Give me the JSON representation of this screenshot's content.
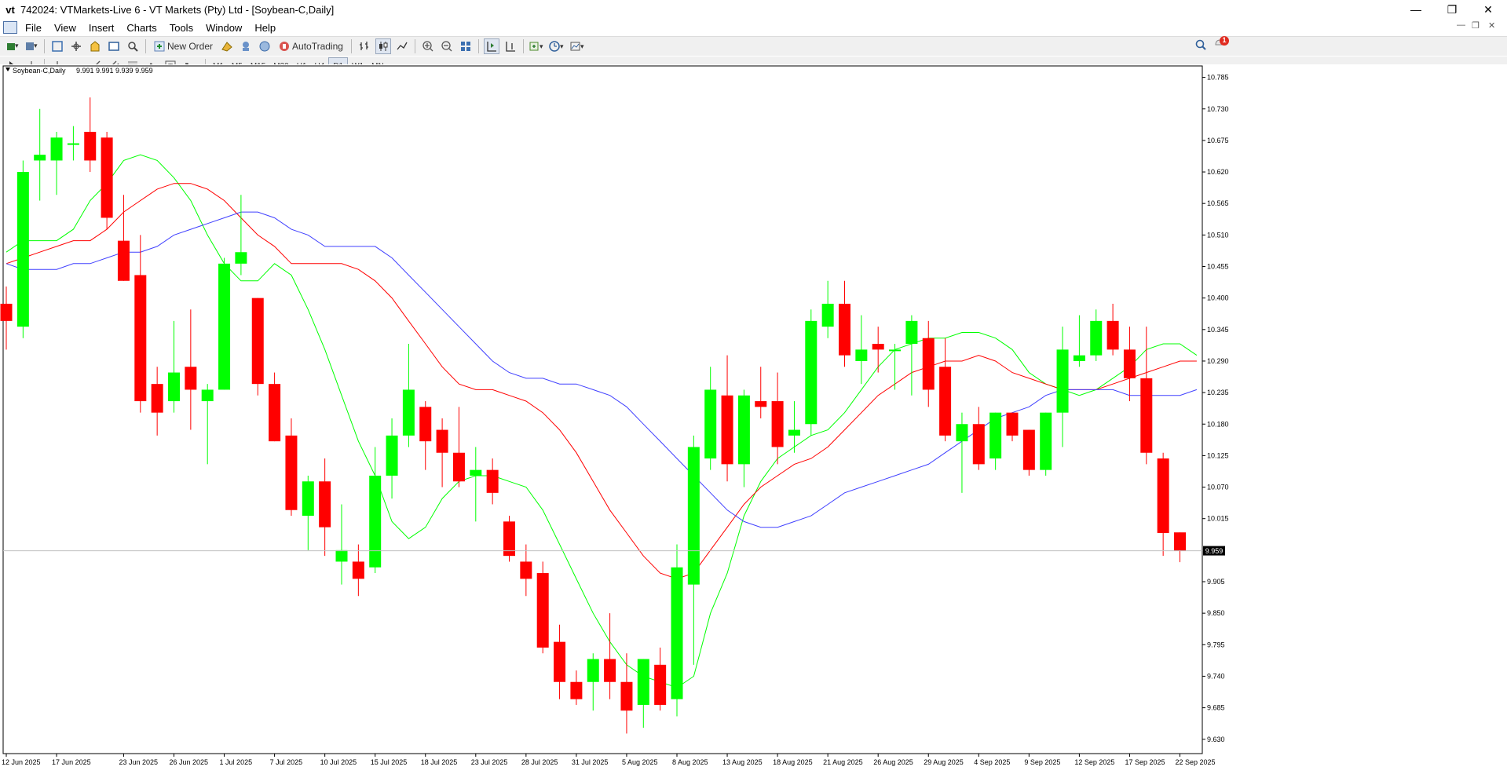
{
  "window": {
    "title": "742024: VTMarkets-Live 6 - VT Markets (Pty) Ltd - [Soybean-C,Daily]",
    "logo": "vt"
  },
  "menu": [
    "File",
    "View",
    "Insert",
    "Charts",
    "Tools",
    "Window",
    "Help"
  ],
  "toolbar": {
    "new_order": "New Order",
    "autotrading": "AutoTrading",
    "notification_count": "1"
  },
  "timeframes": [
    "M1",
    "M5",
    "M15",
    "M30",
    "H1",
    "H4",
    "D1",
    "W1",
    "MN"
  ],
  "active_timeframe": "D1",
  "icons": {
    "minimize": "minimize-icon",
    "maximize": "restore-icon",
    "close": "close-icon",
    "search": "search-icon",
    "notification": "notification-icon"
  },
  "chart_data": {
    "type": "candlestick",
    "title": "Soybean-C,Daily",
    "ohlc_label": "9.991 9.991 9.939 9.959",
    "current_price": 9.959,
    "current_price_label": "9.959",
    "ylim": [
      9.605,
      10.805
    ],
    "y_ticks": [
      9.63,
      9.685,
      9.74,
      9.795,
      9.85,
      9.905,
      10.015,
      10.07,
      10.125,
      10.18,
      10.235,
      10.29,
      10.345,
      10.4,
      10.455,
      10.51,
      10.565,
      10.62,
      10.675,
      10.73,
      10.785
    ],
    "x_tick_labels": [
      {
        "i": 0,
        "label": "12 Jun 2025"
      },
      {
        "i": 3,
        "label": "17 Jun 2025"
      },
      {
        "i": 7,
        "label": "23 Jun 2025"
      },
      {
        "i": 10,
        "label": "26 Jun 2025"
      },
      {
        "i": 13,
        "label": "1 Jul 2025"
      },
      {
        "i": 16,
        "label": "7 Jul 2025"
      },
      {
        "i": 19,
        "label": "10 Jul 2025"
      },
      {
        "i": 22,
        "label": "15 Jul 2025"
      },
      {
        "i": 25,
        "label": "18 Jul 2025"
      },
      {
        "i": 28,
        "label": "23 Jul 2025"
      },
      {
        "i": 31,
        "label": "28 Jul 2025"
      },
      {
        "i": 34,
        "label": "31 Jul 2025"
      },
      {
        "i": 37,
        "label": "5 Aug 2025"
      },
      {
        "i": 40,
        "label": "8 Aug 2025"
      },
      {
        "i": 43,
        "label": "13 Aug 2025"
      },
      {
        "i": 46,
        "label": "18 Aug 2025"
      },
      {
        "i": 49,
        "label": "21 Aug 2025"
      },
      {
        "i": 52,
        "label": "26 Aug 2025"
      },
      {
        "i": 55,
        "label": "29 Aug 2025"
      },
      {
        "i": 58,
        "label": "4 Sep 2025"
      },
      {
        "i": 61,
        "label": "9 Sep 2025"
      },
      {
        "i": 64,
        "label": "12 Sep 2025"
      },
      {
        "i": 67,
        "label": "17 Sep 2025"
      },
      {
        "i": 70,
        "label": "22 Sep 2025"
      }
    ],
    "candles": [
      [
        10.39,
        10.42,
        10.31,
        10.36
      ],
      [
        10.35,
        10.64,
        10.33,
        10.62
      ],
      [
        10.64,
        10.73,
        10.57,
        10.65
      ],
      [
        10.64,
        10.69,
        10.58,
        10.68
      ],
      [
        10.67,
        10.7,
        10.64,
        10.67
      ],
      [
        10.69,
        10.75,
        10.62,
        10.64
      ],
      [
        10.68,
        10.69,
        10.52,
        10.54
      ],
      [
        10.5,
        10.58,
        10.43,
        10.43
      ],
      [
        10.44,
        10.51,
        10.2,
        10.22
      ],
      [
        10.25,
        10.28,
        10.16,
        10.2
      ],
      [
        10.22,
        10.36,
        10.2,
        10.27
      ],
      [
        10.28,
        10.38,
        10.17,
        10.24
      ],
      [
        10.22,
        10.25,
        10.11,
        10.24
      ],
      [
        10.24,
        10.47,
        10.24,
        10.46
      ],
      [
        10.46,
        10.58,
        10.44,
        10.48
      ],
      [
        10.4,
        10.4,
        10.23,
        10.25
      ],
      [
        10.25,
        10.27,
        10.15,
        10.15
      ],
      [
        10.16,
        10.19,
        10.02,
        10.03
      ],
      [
        10.02,
        10.09,
        9.96,
        10.08
      ],
      [
        10.08,
        10.12,
        9.95,
        10.0
      ],
      [
        9.94,
        10.04,
        9.9,
        9.96
      ],
      [
        9.94,
        9.97,
        9.88,
        9.91
      ],
      [
        9.93,
        10.14,
        9.92,
        10.09
      ],
      [
        10.09,
        10.19,
        10.05,
        10.16
      ],
      [
        10.16,
        10.32,
        10.14,
        10.24
      ],
      [
        10.21,
        10.22,
        10.1,
        10.15
      ],
      [
        10.17,
        10.19,
        10.07,
        10.13
      ],
      [
        10.13,
        10.21,
        10.07,
        10.08
      ],
      [
        10.09,
        10.14,
        10.01,
        10.1
      ],
      [
        10.1,
        10.12,
        10.04,
        10.06
      ],
      [
        10.01,
        10.02,
        9.94,
        9.95
      ],
      [
        9.94,
        9.97,
        9.88,
        9.91
      ],
      [
        9.92,
        9.94,
        9.78,
        9.79
      ],
      [
        9.8,
        9.83,
        9.7,
        9.73
      ],
      [
        9.73,
        9.75,
        9.69,
        9.7
      ],
      [
        9.73,
        9.78,
        9.68,
        9.77
      ],
      [
        9.77,
        9.85,
        9.7,
        9.73
      ],
      [
        9.73,
        9.78,
        9.64,
        9.68
      ],
      [
        9.69,
        9.77,
        9.65,
        9.77
      ],
      [
        9.76,
        9.79,
        9.68,
        9.69
      ],
      [
        9.7,
        9.97,
        9.67,
        9.93
      ],
      [
        9.9,
        10.16,
        9.76,
        10.14
      ],
      [
        10.12,
        10.28,
        10.1,
        10.24
      ],
      [
        10.23,
        10.3,
        10.08,
        10.11
      ],
      [
        10.11,
        10.24,
        10.07,
        10.23
      ],
      [
        10.22,
        10.28,
        10.19,
        10.21
      ],
      [
        10.22,
        10.27,
        10.11,
        10.14
      ],
      [
        10.16,
        10.22,
        10.13,
        10.17
      ],
      [
        10.18,
        10.38,
        10.16,
        10.36
      ],
      [
        10.35,
        10.43,
        10.33,
        10.39
      ],
      [
        10.39,
        10.43,
        10.28,
        10.3
      ],
      [
        10.29,
        10.37,
        10.25,
        10.31
      ],
      [
        10.32,
        10.35,
        10.27,
        10.31
      ],
      [
        10.31,
        10.32,
        10.24,
        10.31
      ],
      [
        10.32,
        10.37,
        10.23,
        10.36
      ],
      [
        10.33,
        10.36,
        10.21,
        10.24
      ],
      [
        10.28,
        10.33,
        10.15,
        10.16
      ],
      [
        10.15,
        10.2,
        10.06,
        10.18
      ],
      [
        10.18,
        10.21,
        10.1,
        10.11
      ],
      [
        10.12,
        10.2,
        10.1,
        10.2
      ],
      [
        10.2,
        10.2,
        10.15,
        10.16
      ],
      [
        10.17,
        10.17,
        10.09,
        10.1
      ],
      [
        10.1,
        10.2,
        10.09,
        10.2
      ],
      [
        10.2,
        10.35,
        10.14,
        10.31
      ],
      [
        10.29,
        10.37,
        10.28,
        10.3
      ],
      [
        10.3,
        10.38,
        10.29,
        10.36
      ],
      [
        10.36,
        10.39,
        10.3,
        10.31
      ],
      [
        10.31,
        10.35,
        10.22,
        10.26
      ],
      [
        10.26,
        10.35,
        10.11,
        10.13
      ],
      [
        10.12,
        10.13,
        9.95,
        9.99
      ],
      [
        9.991,
        9.991,
        9.939,
        9.959
      ]
    ],
    "series": [
      {
        "color": "#00ff00",
        "values": [
          10.48,
          10.5,
          10.5,
          10.5,
          10.52,
          10.57,
          10.6,
          10.64,
          10.65,
          10.64,
          10.61,
          10.57,
          10.51,
          10.46,
          10.43,
          10.43,
          10.46,
          10.44,
          10.38,
          10.31,
          10.23,
          10.15,
          10.09,
          10.01,
          9.98,
          10.0,
          10.05,
          10.08,
          10.09,
          10.09,
          10.08,
          10.07,
          10.03,
          9.97,
          9.91,
          9.85,
          9.8,
          9.76,
          9.74,
          9.73,
          9.72,
          9.74,
          9.85,
          9.92,
          10.02,
          10.08,
          10.12,
          10.14,
          10.16,
          10.17,
          10.2,
          10.24,
          10.28,
          10.31,
          10.32,
          10.33,
          10.33,
          10.34,
          10.34,
          10.33,
          10.31,
          10.27,
          10.25,
          10.24,
          10.23,
          10.24,
          10.26,
          10.28,
          10.31,
          10.32,
          10.32,
          10.3
        ]
      },
      {
        "color": "#ff0000",
        "values": [
          10.46,
          10.47,
          10.48,
          10.49,
          10.5,
          10.5,
          10.52,
          10.55,
          10.57,
          10.59,
          10.6,
          10.6,
          10.59,
          10.57,
          10.54,
          10.51,
          10.49,
          10.46,
          10.46,
          10.46,
          10.46,
          10.45,
          10.43,
          10.4,
          10.36,
          10.32,
          10.28,
          10.25,
          10.24,
          10.24,
          10.23,
          10.22,
          10.2,
          10.17,
          10.13,
          10.08,
          10.03,
          9.99,
          9.95,
          9.92,
          9.91,
          9.92,
          9.96,
          10.0,
          10.04,
          10.07,
          10.09,
          10.11,
          10.12,
          10.14,
          10.17,
          10.2,
          10.23,
          10.25,
          10.27,
          10.28,
          10.29,
          10.29,
          10.3,
          10.29,
          10.27,
          10.26,
          10.25,
          10.24,
          10.24,
          10.24,
          10.25,
          10.26,
          10.27,
          10.28,
          10.29,
          10.29
        ]
      },
      {
        "color": "#4040ff",
        "values": [
          10.46,
          10.45,
          10.45,
          10.45,
          10.46,
          10.46,
          10.47,
          10.48,
          10.48,
          10.49,
          10.51,
          10.52,
          10.53,
          10.54,
          10.55,
          10.55,
          10.54,
          10.52,
          10.51,
          10.49,
          10.49,
          10.49,
          10.49,
          10.47,
          10.44,
          10.41,
          10.38,
          10.35,
          10.32,
          10.29,
          10.27,
          10.26,
          10.26,
          10.25,
          10.25,
          10.24,
          10.23,
          10.21,
          10.18,
          10.15,
          10.12,
          10.09,
          10.06,
          10.03,
          10.01,
          10.0,
          10.0,
          10.01,
          10.02,
          10.04,
          10.06,
          10.07,
          10.08,
          10.09,
          10.1,
          10.11,
          10.13,
          10.15,
          10.17,
          10.19,
          10.2,
          10.21,
          10.23,
          10.24,
          10.24,
          10.24,
          10.24,
          10.23,
          10.23,
          10.23,
          10.23,
          10.24
        ]
      }
    ]
  }
}
